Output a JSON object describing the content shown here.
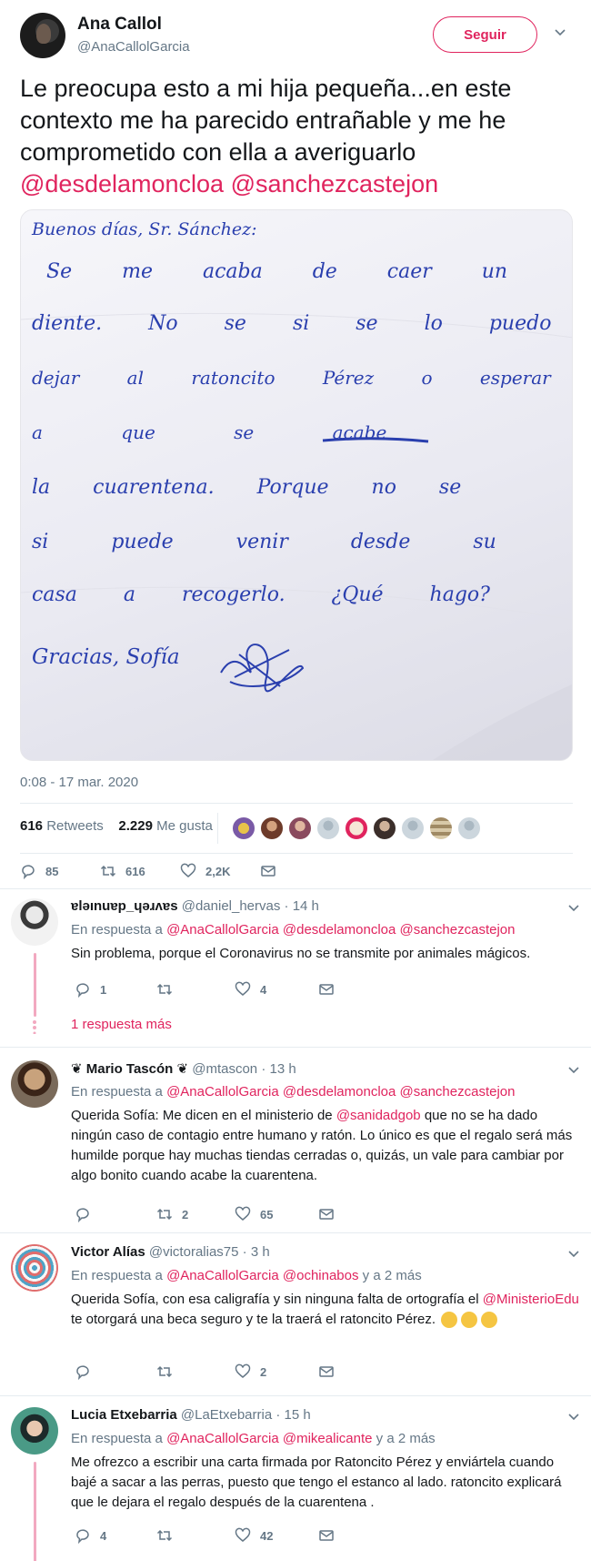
{
  "tweet": {
    "name": "Ana Callol",
    "handle": "@AnaCallolGarcia",
    "follow_label": "Seguir",
    "text": "Le preocupa esto a mi hija pequeña...en este contexto me ha parecido entrañable y me he comprometido con ella a averiguarlo",
    "mention1": "@desdelamoncloa",
    "mention2": "@sanchezcastejon",
    "note": {
      "l1": "Buenos días, Sr. Sánchez:",
      "l2": "Se me acaba de caer un",
      "l3": "diente. No se si se lo puedo",
      "l4": "dejar al ratoncito Pérez o esperar",
      "l5": "a que se acabe",
      "l6": "la cuarentena. Porque no se",
      "l7": "si puede venir desde su",
      "l8": "casa a recogerlo. ¿Qué hago?",
      "l9": "Gracias, Sofía"
    },
    "date": "0:08 - 17 mar. 2020",
    "retweets_count": "616",
    "retweets_label": "Retweets",
    "likes_count": "2.229",
    "likes_label": "Me gusta",
    "action_replies": "85",
    "action_retweets": "616",
    "action_likes": "2,2K"
  },
  "replies": [
    {
      "name": "ɐlǝınuɐp_ɥǝɹʌɐs",
      "handle": "@daniel_hervas",
      "time": "· 14 h",
      "to_label": "En respuesta a",
      "to1": "@AnaCallolGarcia",
      "to2": "@desdelamoncloa",
      "to3": "@sanchezcastejon",
      "text": "Sin problema, porque el Coronavirus no se transmite por animales mágicos.",
      "replies": "1",
      "retweets": "",
      "likes": "4",
      "more": "1 respuesta más"
    },
    {
      "name": "❦ Mario Tascón ❦",
      "handle": "@mtascon",
      "time": "· 13 h",
      "to_label": "En respuesta a",
      "to1": "@AnaCallolGarcia",
      "to2": "@desdelamoncloa",
      "to3": "@sanchezcastejon",
      "text_a": "Querida Sofía: Me dicen en el ministerio de",
      "mention": "@sanidadgob",
      "text_b": "que no se ha dado ningún caso de contagio entre humano y ratón. Lo único es que el regalo será más humilde porque hay muchas tiendas cerradas o, quizás, un vale para cambiar por algo bonito cuando acabe la cuarentena.",
      "replies": "",
      "retweets": "2",
      "likes": "65"
    },
    {
      "name": "Victor Alías",
      "handle": "@victoralias75",
      "time": "· 3 h",
      "to_label": "En respuesta a",
      "to1": "@AnaCallolGarcia",
      "to2": "@ochinabos",
      "to_more": "y a 2 más",
      "text_a": "Querida Sofía, con esa caligrafía y sin ninguna falta de ortografía el",
      "mention": "@MinisterioEdu",
      "text_b": "te otorgará una beca seguro y te la traerá el ratoncito Pérez.",
      "replies": "",
      "retweets": "",
      "likes": "2"
    },
    {
      "name": "Lucia Etxebarria",
      "handle": "@LaEtxebarria",
      "time": "· 15 h",
      "to_label": "En respuesta a",
      "to1": "@AnaCallolGarcia",
      "to2": "@mikealicante",
      "to_more": "y a 2 más",
      "text": "Me ofrezco a escribir una carta firmada por Ratoncito Pérez y enviártela cuando bajé a sacar a las perras, puesto que tengo el estanco al lado. ratoncito explicará que le dejara el regalo después de la cuarentena .",
      "replies": "4",
      "retweets": "",
      "likes": "42"
    }
  ],
  "icons": [
    "reply-icon",
    "retweet-icon",
    "like-icon",
    "message-icon",
    "chevron-down-icon"
  ],
  "colors": {
    "accent": "#e0245e",
    "muted": "#657786",
    "text": "#14171a",
    "ink": "#2a3fae"
  }
}
